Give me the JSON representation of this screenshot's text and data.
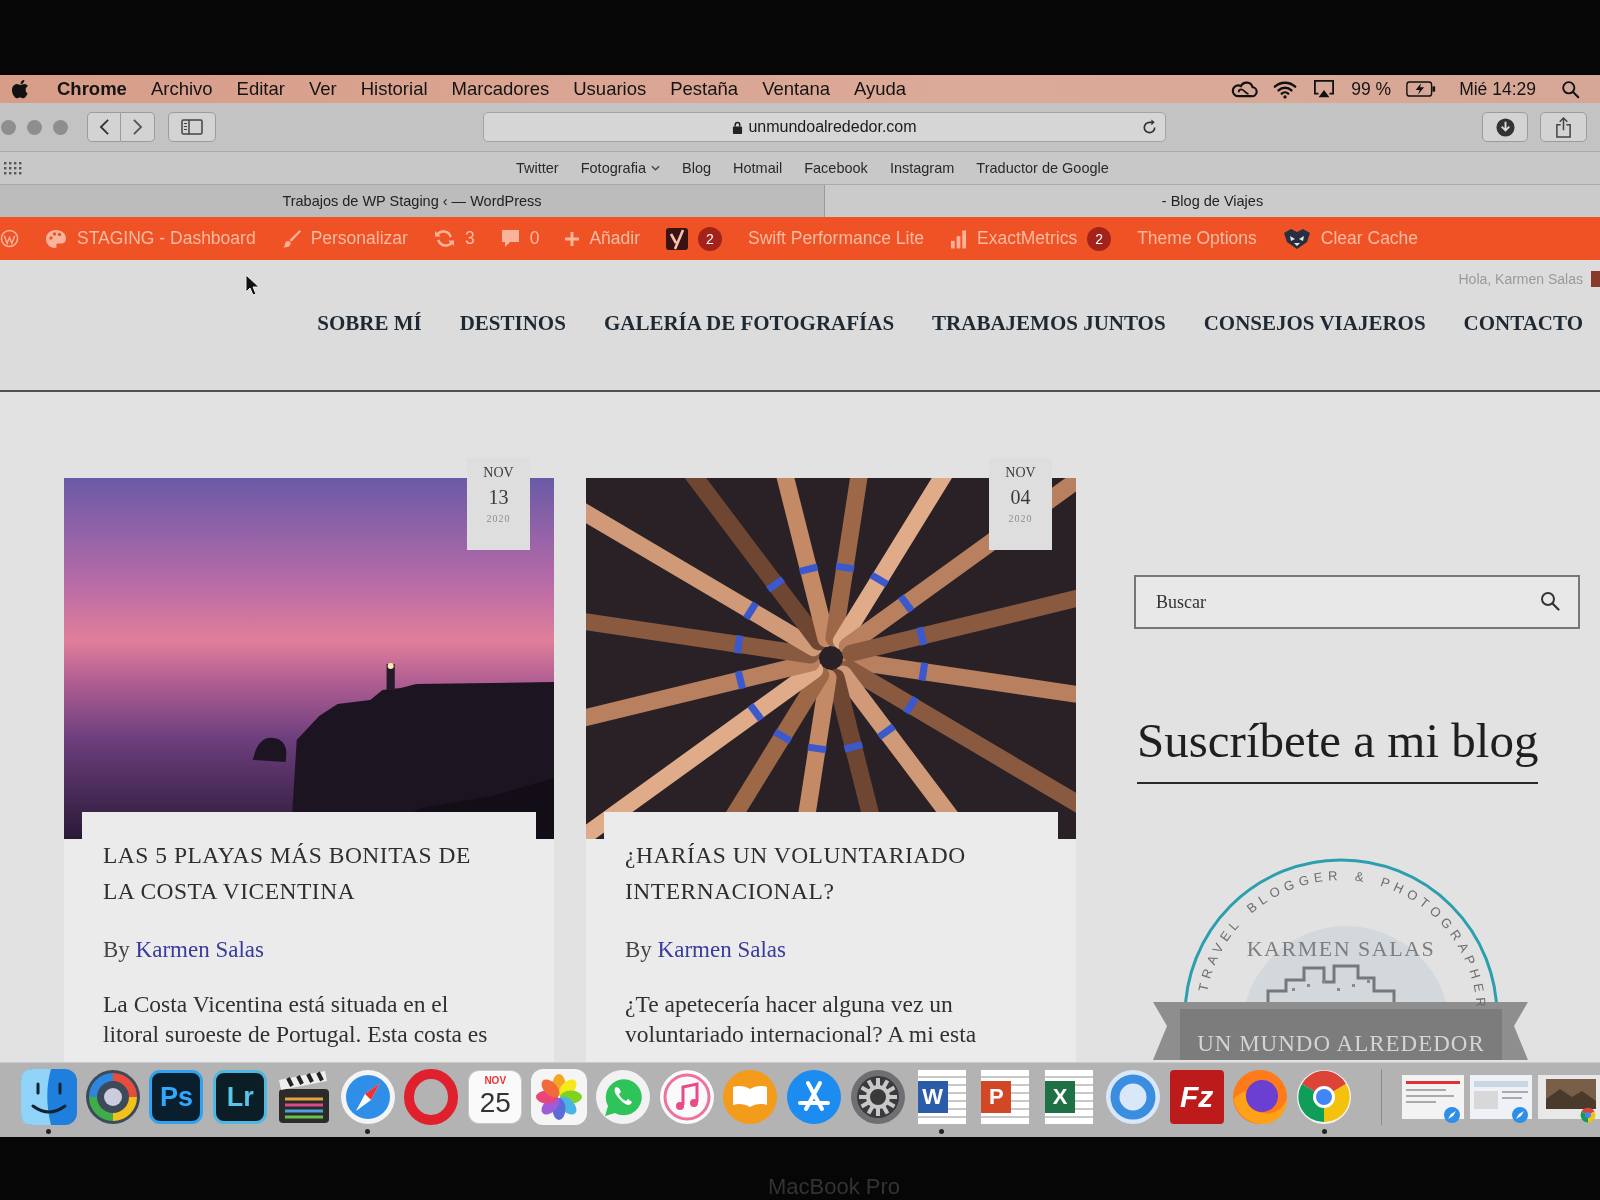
{
  "menu_bar": {
    "app": "Chrome",
    "menus": [
      "Archivo",
      "Editar",
      "Ver",
      "Historial",
      "Marcadores",
      "Usuarios",
      "Pestaña",
      "Ventana",
      "Ayuda"
    ],
    "battery": "99 %",
    "charging": true,
    "clock": "Mié 14:29"
  },
  "toolbar": {
    "url": "unmundoalrededor.com",
    "secure": true
  },
  "bookmarks": [
    {
      "label": "Twitter",
      "kind": "link"
    },
    {
      "label": "Fotografia",
      "kind": "folder"
    },
    {
      "label": "Blog",
      "kind": "link"
    },
    {
      "label": "Hotmail",
      "kind": "link"
    },
    {
      "label": "Facebook",
      "kind": "link"
    },
    {
      "label": "Instagram",
      "kind": "link"
    },
    {
      "label": "Traductor de Google",
      "kind": "link"
    }
  ],
  "tabs": [
    {
      "title": "Trabajos de WP Staging ‹ — WordPress",
      "selected": false
    },
    {
      "title": "- Blog de Viajes",
      "selected": true
    }
  ],
  "admin_bar": {
    "items": [
      {
        "kind": "site",
        "label": "STAGING - Dashboard"
      },
      {
        "kind": "customize",
        "label": "Personalizar"
      },
      {
        "kind": "updates",
        "label": "3"
      },
      {
        "kind": "comments",
        "label": "0"
      },
      {
        "kind": "new",
        "label": "Añadir"
      },
      {
        "kind": "seo",
        "badge": "2"
      },
      {
        "kind": "plain",
        "label": "Swift Performance Lite"
      },
      {
        "kind": "metrics",
        "label": "ExactMetrics",
        "badge": "2"
      },
      {
        "kind": "plain",
        "label": "Theme Options"
      },
      {
        "kind": "cache",
        "label": "Clear Cache"
      }
    ],
    "greeting": "Hola, Karmen Salas"
  },
  "nav": [
    "SOBRE MÍ",
    "DESTINOS",
    "GALERÍA DE FOTOGRAFÍAS",
    "TRABAJEMOS JUNTOS",
    "CONSEJOS VIAJEROS",
    "CONTACTO"
  ],
  "posts": [
    {
      "kind": "sunset",
      "month": "NOV",
      "day": "13",
      "year": "2020",
      "title": "LAS 5 PLAYAS MÁS BONITAS DE LA COSTA VICENTINA",
      "by": "By",
      "author": "Karmen Salas",
      "excerpt": "La Costa Vicentina está situada en el litoral suroeste de Portugal. Esta costa es"
    },
    {
      "kind": "hands",
      "month": "NOV",
      "day": "04",
      "year": "2020",
      "title": "¿HARÍAS UN VOLUNTARIADO INTERNACIONAL?",
      "by": "By",
      "author": "Karmen Salas",
      "excerpt": "¿Te apetecería hacer alguna vez un voluntariado internacional? A mi esta"
    }
  ],
  "sidebar": {
    "search": {
      "placeholder": "Buscar"
    },
    "widget_title": "Suscríbete a mi blog",
    "logo": {
      "tagline_words": [
        "TRAVEL",
        "BLOGGER",
        "&",
        "PHOTOGRAPHER"
      ],
      "name": "KARMEN SALAS",
      "banner": "UN MUNDO ALREDEDOR"
    }
  },
  "dock": {
    "items": [
      {
        "kind": "finder",
        "running": true
      },
      {
        "kind": "ring",
        "running": false
      },
      {
        "kind": "ps",
        "label": "Ps",
        "running": false
      },
      {
        "kind": "lr",
        "label": "Lr",
        "running": false
      },
      {
        "kind": "clapper",
        "running": false
      },
      {
        "kind": "compass",
        "running": true
      },
      {
        "kind": "opera",
        "running": false
      },
      {
        "kind": "calendar",
        "month": "NOV",
        "day": "25",
        "running": false
      },
      {
        "kind": "photos",
        "running": false
      },
      {
        "kind": "chat",
        "running": false
      },
      {
        "kind": "music",
        "running": false
      },
      {
        "kind": "books",
        "running": false
      },
      {
        "kind": "store",
        "running": false
      },
      {
        "kind": "gear",
        "running": false
      },
      {
        "kind": "word",
        "label": "W",
        "running": true
      },
      {
        "kind": "slides",
        "label": "P",
        "running": false
      },
      {
        "kind": "sheet",
        "label": "X",
        "running": false
      },
      {
        "kind": "globe",
        "running": false
      },
      {
        "kind": "fz",
        "label": "Fz",
        "running": false
      },
      {
        "kind": "firefox",
        "running": false
      },
      {
        "kind": "chrome",
        "running": true
      },
      {
        "kind": "window"
      },
      {
        "kind": "window"
      },
      {
        "kind": "window"
      }
    ]
  },
  "bezel_label": "MacBook Pro"
}
